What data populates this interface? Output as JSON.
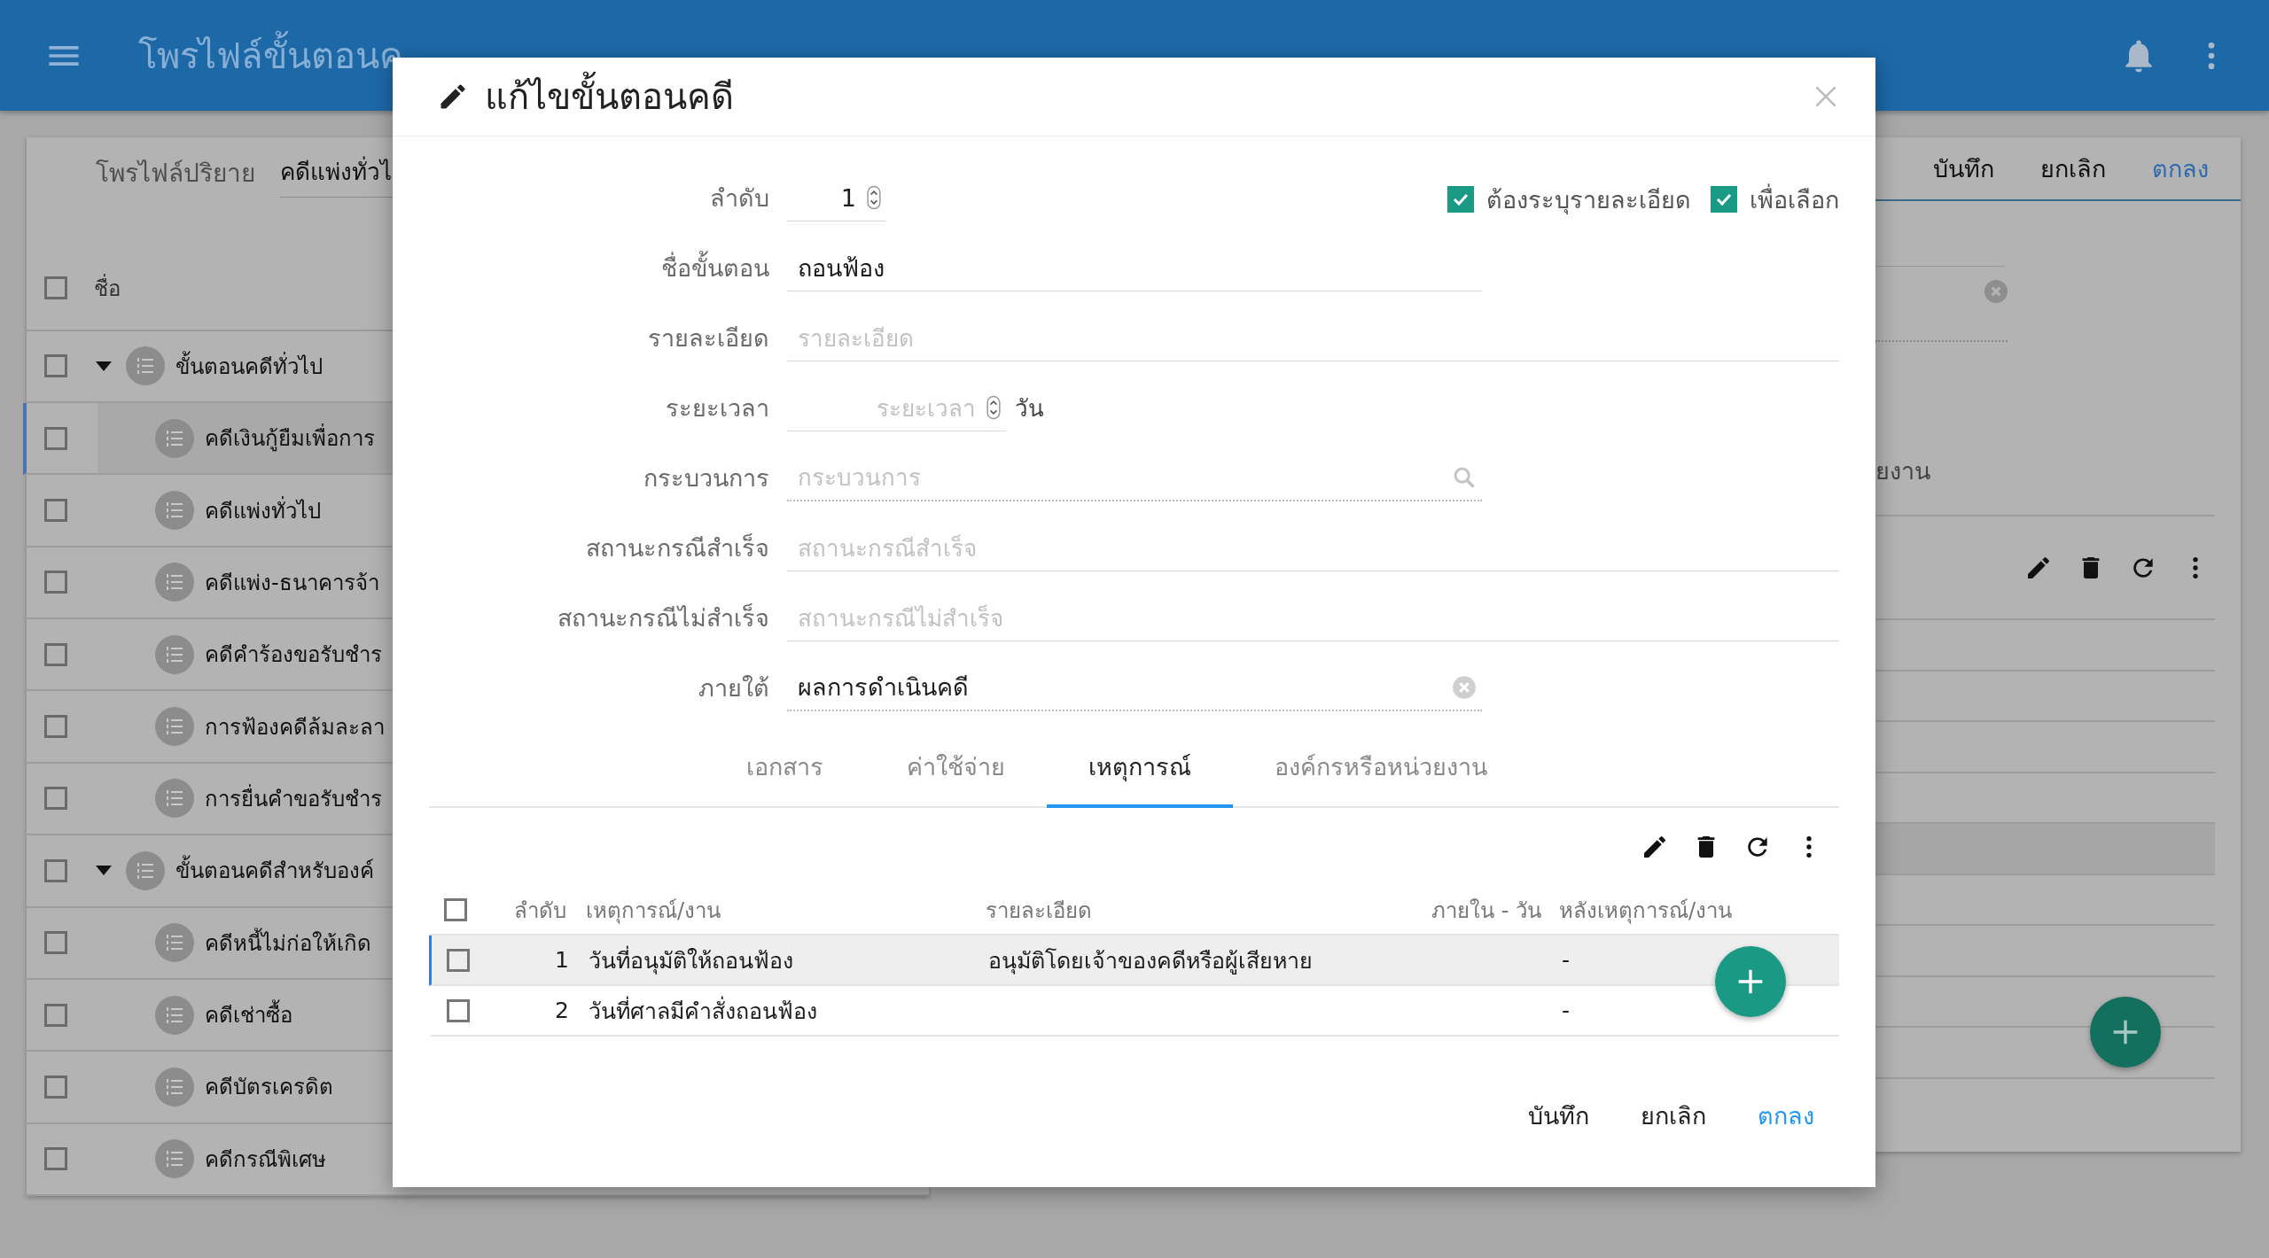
{
  "app_bar": {
    "title": "โพรไฟล์ขั้นตอนค"
  },
  "profile_panel": {
    "default_profile": {
      "label": "โพรไฟล์ปริยาย",
      "value": "คดีแพ่งทั่วไ"
    },
    "header": {
      "label": "ชื่อ",
      "checked": false
    },
    "tree": [
      {
        "label": "ขั้นตอนคดีทั่วไป",
        "checked": false,
        "selected": false,
        "expanded": true,
        "children": [
          {
            "label": "คดีเงินกู้ยืมเพื่อการ",
            "checked": false,
            "selected": true
          },
          {
            "label": "คดีแพ่งทั่วไป",
            "checked": false,
            "selected": false
          },
          {
            "label": "คดีแพ่ง-ธนาคารจ้า",
            "checked": false,
            "selected": false
          },
          {
            "label": "คดีคำร้องขอรับชำร",
            "checked": false,
            "selected": false
          },
          {
            "label": "การฟ้องคดีล้มละลา",
            "checked": false,
            "selected": false
          },
          {
            "label": "การยื่นคำขอรับชำร",
            "checked": false,
            "selected": false
          }
        ]
      },
      {
        "label": "ขั้นตอนคดีสำหรับองค์",
        "checked": false,
        "selected": false,
        "expanded": true,
        "children": [
          {
            "label": "คดีหนี้ไม่ก่อให้เกิด",
            "checked": false,
            "selected": false
          },
          {
            "label": "คดีเช่าซื้อ",
            "checked": false,
            "selected": false
          },
          {
            "label": "คดีบัตรเครดิต",
            "checked": false,
            "selected": false
          },
          {
            "label": "คดีกรณีพิเศษ",
            "checked": false,
            "selected": false
          }
        ]
      }
    ]
  },
  "detail_panel": {
    "buttons": [
      {
        "label": "บันทึก",
        "kind": "plain"
      },
      {
        "label": "ยกเลิก",
        "kind": "plain"
      },
      {
        "label": "ตกลง",
        "kind": "primary"
      }
    ],
    "tab_fragment": "ยงาน"
  },
  "dialog": {
    "title": "แก้ไขขั้นตอนคดี",
    "options": [
      {
        "label": "ต้องระบุรายละเอียด",
        "checked": true
      },
      {
        "label": "เพื่อเลือก",
        "checked": true
      }
    ],
    "fields": [
      {
        "kind": "spinner",
        "label": "ลำดับ",
        "value": "1"
      },
      {
        "kind": "short-text",
        "label": "ชื่อขั้นตอน",
        "value": "ถอนฟ้อง"
      },
      {
        "kind": "text",
        "label": "รายละเอียด",
        "placeholder": "รายละเอียด"
      },
      {
        "kind": "duration",
        "label": "ระยะเวลา",
        "placeholder": "ระยะเวลา",
        "unit": "วัน"
      },
      {
        "kind": "lookup",
        "label": "กระบวนการ",
        "placeholder": "กระบวนการ"
      },
      {
        "kind": "text",
        "label": "สถานะกรณีสำเร็จ",
        "placeholder": "สถานะกรณีสำเร็จ"
      },
      {
        "kind": "text",
        "label": "สถานะกรณีไม่สำเร็จ",
        "placeholder": "สถานะกรณีไม่สำเร็จ"
      },
      {
        "kind": "lookup",
        "label": "ภายใต้",
        "value": "ผลการดำเนินคดี"
      }
    ],
    "tabs": [
      {
        "label": "เอกสาร",
        "selected": false
      },
      {
        "label": "ค่าใช้จ่าย",
        "selected": false
      },
      {
        "label": "เหตุการณ์",
        "selected": true
      },
      {
        "label": "องค์กรหรือหน่วยงาน",
        "selected": false
      }
    ],
    "table": {
      "header_checked": false,
      "columns": [
        "ลำดับ",
        "เหตุการณ์/งาน",
        "รายละเอียด",
        "ภายใน - วัน",
        "หลังเหตุการณ์/งาน"
      ],
      "rows": [
        {
          "checked": false,
          "selected": true,
          "order": "1",
          "event": "วันที่อนุมัติให้ถอนฟ้อง",
          "detail": "อนุมัติโดยเจ้าของคดีหรือผู้เสียหาย",
          "after": "-"
        },
        {
          "checked": false,
          "selected": false,
          "order": "2",
          "event": "วันที่ศาลมีคำสั่งถอนฟ้อง",
          "after": "-"
        }
      ]
    },
    "buttons": [
      {
        "label": "บันทึก",
        "kind": "plain"
      },
      {
        "label": "ยกเลิก",
        "kind": "plain"
      },
      {
        "label": "ตกลง",
        "kind": "primary"
      }
    ]
  }
}
